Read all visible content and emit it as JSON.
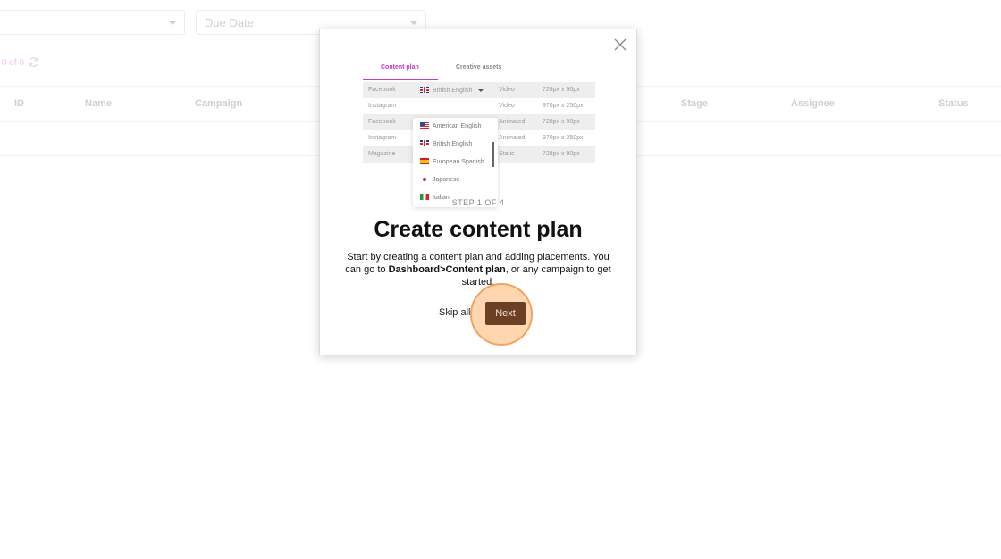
{
  "filters": {
    "first": {
      "placeholder": ""
    },
    "due_date": {
      "placeholder": "Due Date"
    }
  },
  "pager": {
    "text": "0 of 0"
  },
  "table": {
    "columns": [
      "ID",
      "Name",
      "Campaign",
      "Stage",
      "Assignee",
      "Status"
    ]
  },
  "onboarding": {
    "tabs": [
      {
        "label": "Content plan",
        "active": true
      },
      {
        "label": "Creative assets",
        "active": false
      }
    ],
    "preview_rows": [
      {
        "channel": "Facebook",
        "language": "British English",
        "format": "Video",
        "size": "728px x 90px"
      },
      {
        "channel": "Instagram",
        "language": "",
        "format": "Video",
        "size": "970px x 250px"
      },
      {
        "channel": "Facebook",
        "language": "",
        "format": "Animated",
        "size": "728px x 90px"
      },
      {
        "channel": "Instagram",
        "language": "",
        "format": "Animated",
        "size": "970px x 250px"
      },
      {
        "channel": "Magazine",
        "language": "",
        "format": "Static",
        "size": "728px x 90px"
      }
    ],
    "language_options": [
      {
        "label": "American English",
        "flag": "us-flag-icon"
      },
      {
        "label": "British English",
        "flag": "uk-flag-icon"
      },
      {
        "label": "European Spanish",
        "flag": "es-flag-icon"
      },
      {
        "label": "Japanese",
        "flag": "jp-flag-icon"
      },
      {
        "label": "Italian",
        "flag": "it-flag-icon"
      }
    ],
    "step_label": "STEP 1 OF 4",
    "title": "Create content plan",
    "description_1": "Start by creating a content plan and adding placements. You can go to ",
    "description_bold": "Dashboard>Content plan",
    "description_2": ", or any campaign to get started.",
    "skip_label": "Skip all",
    "next_label": "Next",
    "colors": {
      "accent": "#c13dc0",
      "next_button": "#6b3f24",
      "highlight": "#f5a25a"
    }
  }
}
